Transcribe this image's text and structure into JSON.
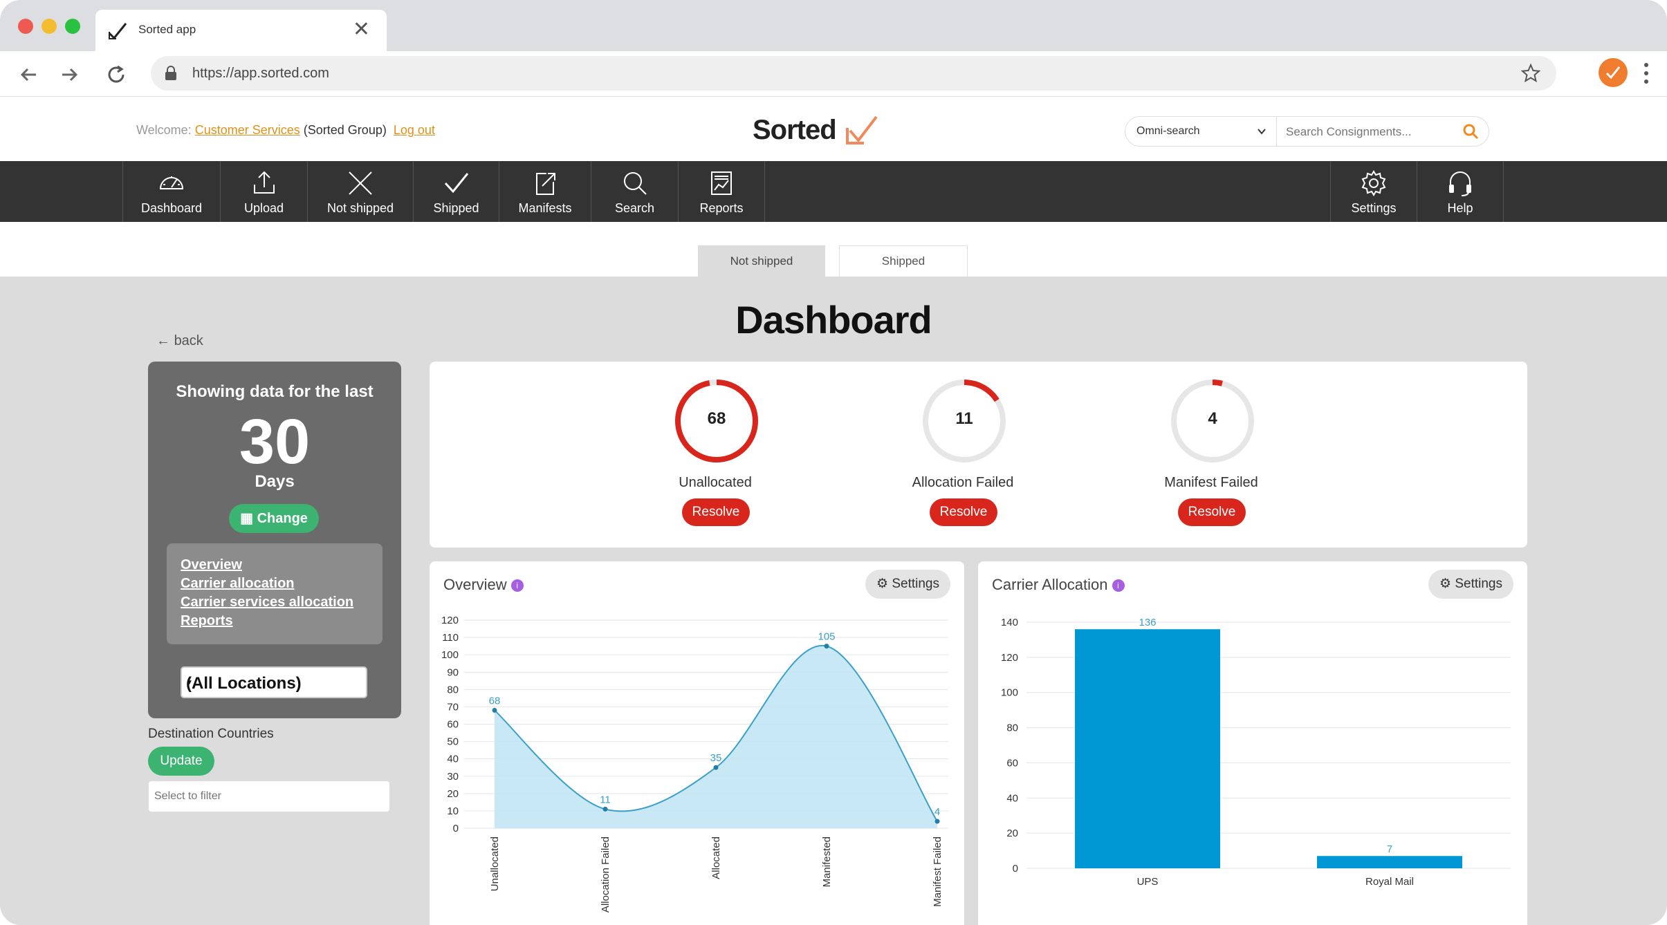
{
  "browser": {
    "tab_title": "Sorted app",
    "url": "https://app.sorted.com"
  },
  "header": {
    "welcome_prefix": "Welcome:",
    "user_link": "Customer Services",
    "group": "(Sorted Group)",
    "logout": "Log out",
    "logo_text": "Sorted",
    "omni_label": "Omni-search",
    "search_placeholder": "Search Consignments..."
  },
  "nav": {
    "items": [
      {
        "label": "Dashboard",
        "icon": "gauge-icon"
      },
      {
        "label": "Upload",
        "icon": "upload-icon"
      },
      {
        "label": "Not shipped",
        "icon": "x-icon"
      },
      {
        "label": "Shipped",
        "icon": "check-icon"
      },
      {
        "label": "Manifests",
        "icon": "manifest-icon"
      },
      {
        "label": "Search",
        "icon": "search-icon"
      },
      {
        "label": "Reports",
        "icon": "reports-icon"
      }
    ],
    "right_items": [
      {
        "label": "Settings",
        "icon": "gear-icon"
      },
      {
        "label": "Help",
        "icon": "headset-icon"
      }
    ]
  },
  "subtabs": [
    "Not shipped",
    "Shipped"
  ],
  "page": {
    "title": "Dashboard",
    "back": "back"
  },
  "sidebar": {
    "showing": "Showing data for the last",
    "days_value": "30",
    "days_label": "Days",
    "change": "Change",
    "links": [
      "Overview",
      "Carrier allocation",
      "Carrier services allocation",
      "Reports"
    ],
    "location": "(All Locations)",
    "dest_label": "Destination Countries",
    "update": "Update",
    "filter_placeholder": "Select to filter"
  },
  "gauges": [
    {
      "value": "68",
      "label": "Unallocated",
      "button": "Resolve",
      "fraction": 0.97
    },
    {
      "value": "11",
      "label": "Allocation Failed",
      "button": "Resolve",
      "fraction": 0.16
    },
    {
      "value": "4",
      "label": "Manifest Failed",
      "button": "Resolve",
      "fraction": 0.04
    }
  ],
  "colors": {
    "accent_red": "#d9261c",
    "green": "#3cb371",
    "bar_blue": "#0098d4",
    "area_blue": "#bfe4f5",
    "nav_dark": "#333333"
  },
  "overview": {
    "title": "Overview",
    "settings": "Settings"
  },
  "carrier": {
    "title": "Carrier Allocation",
    "settings": "Settings"
  },
  "chart_data": [
    {
      "type": "area",
      "title": "Overview",
      "categories": [
        "Unallocated",
        "Allocation Failed",
        "Allocated",
        "Manifested",
        "Manifest Failed"
      ],
      "values": [
        68,
        11,
        35,
        105,
        4
      ],
      "ylim": [
        0,
        120
      ],
      "yticks": [
        0,
        10,
        20,
        30,
        40,
        50,
        60,
        70,
        80,
        90,
        100,
        110,
        120
      ],
      "grid": true
    },
    {
      "type": "bar",
      "title": "Carrier Allocation",
      "categories": [
        "UPS",
        "Royal Mail"
      ],
      "values": [
        136,
        7
      ],
      "ylim": [
        0,
        140
      ],
      "yticks": [
        0,
        20,
        40,
        60,
        80,
        100,
        120,
        140
      ],
      "grid": true
    }
  ]
}
